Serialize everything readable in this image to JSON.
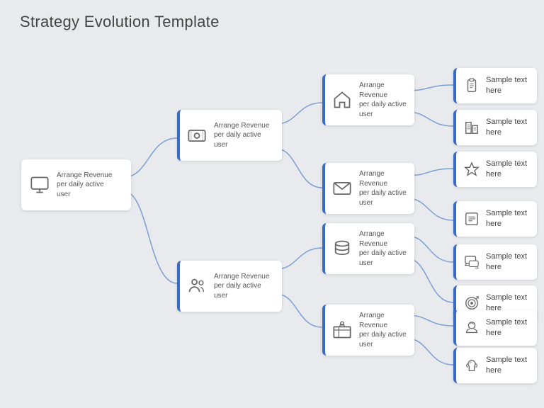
{
  "title": "Strategy Evolution Template",
  "cards": {
    "level1": {
      "label": "Arrange Revenue\nper daily active\nuser",
      "icon": "monitor"
    },
    "level2_top": {
      "label": "Arrange Revenue\nper daily active\nuser",
      "icon": "people"
    },
    "level2_bottom": {
      "label": "Arrange Revenue\nper daily active\nuser",
      "icon": "people-group"
    },
    "level3": [
      {
        "label": "Arrange Revenue\nper daily active\nuser",
        "icon": "house"
      },
      {
        "label": "Arrange Revenue\nper daily active\nuser",
        "icon": "envelope"
      },
      {
        "label": "Arrange Revenue\nper daily active\nuser",
        "icon": "database"
      },
      {
        "label": "Arrange Revenue\nper daily active\nuser",
        "icon": "people-table"
      }
    ],
    "level4": [
      {
        "label": "Sample text here",
        "icon": "clipboard"
      },
      {
        "label": "Sample text here",
        "icon": "building"
      },
      {
        "label": "Sample text here",
        "icon": "star"
      },
      {
        "label": "Sample text here",
        "icon": "checklist"
      },
      {
        "label": "Sample text here",
        "icon": "chat"
      },
      {
        "label": "Sample text here",
        "icon": "target"
      },
      {
        "label": "Sample text here",
        "icon": "brain-head"
      },
      {
        "label": "Sample text here",
        "icon": "brain"
      }
    ]
  }
}
